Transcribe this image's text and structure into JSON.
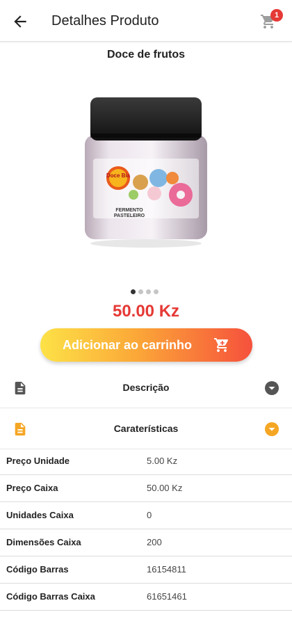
{
  "header": {
    "title": "Detalhes Produto",
    "cart_badge": "1"
  },
  "product": {
    "name": "Doce de frutos",
    "image_labels": {
      "brand": "Doce Bia",
      "line1": "FERMENTO",
      "line2": "PASTELEIRO"
    },
    "carousel": {
      "count": 4,
      "active": 0
    },
    "price": "50.00 Kz"
  },
  "add_to_cart": {
    "label": "Adicionar ao carrinho"
  },
  "sections": {
    "description": {
      "title": "Descrição",
      "icon": "document-icon",
      "color": "#555555"
    },
    "features": {
      "title": "Caraterísticas",
      "icon": "document-icon",
      "color": "#f5a623"
    }
  },
  "specs": [
    {
      "label": "Preço Unidade",
      "value": "5.00 Kz"
    },
    {
      "label": "Preço Caixa",
      "value": "50.00 Kz"
    },
    {
      "label": "Unidades Caixa",
      "value": "0"
    },
    {
      "label": "Dimensões Caixa",
      "value": "200"
    },
    {
      "label": "Código Barras",
      "value": "16154811"
    },
    {
      "label": "Código Barras Caixa",
      "value": "61651461"
    }
  ],
  "colors": {
    "price": "#e53935",
    "badge": "#e53935",
    "accent": "#f5a623"
  }
}
